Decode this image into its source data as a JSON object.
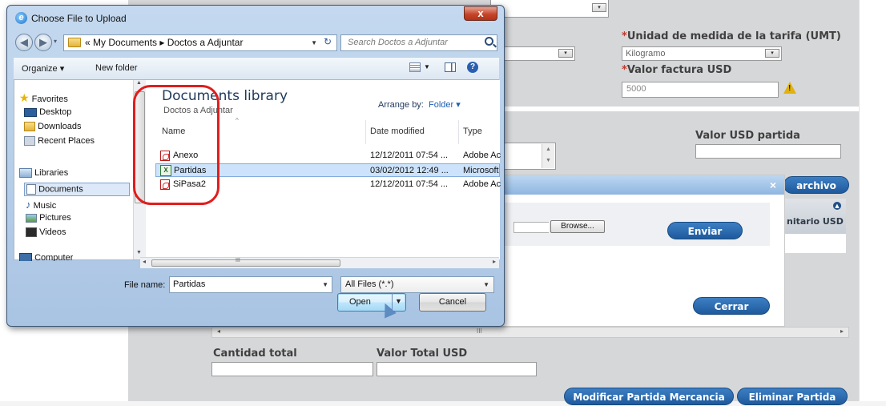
{
  "web": {
    "umt_label": "Unidad de medida de la tarifa (UMT)",
    "umt_value": "Kilogramo",
    "valor_factura_label": "Valor factura USD",
    "valor_factura_value": "5000",
    "valor_usd_partida_label": "Valor USD partida",
    "adjuntar_button": "archivo",
    "precio_unitario_partial": "nitario USD",
    "browse_label": "Browse...",
    "enviar_label": "Enviar",
    "cerrar_label": "Cerrar",
    "cantidad_total_label": "Cantidad total",
    "valor_total_label": "Valor Total USD",
    "modificar_label": "Modificar Partida Mercancia",
    "eliminar_label": "Eliminar Partida",
    "req_mark": "*",
    "x_mark": "×",
    "scroll_mark": "III"
  },
  "dialog": {
    "title": "Choose File to Upload",
    "close_label": "x",
    "breadcrumb": "« My Documents ▸ Doctos a Adjuntar",
    "search_placeholder": "Search Doctos a Adjuntar",
    "organize_label": "Organize ▾",
    "new_folder_label": "New folder",
    "nav": {
      "favorites": "Favorites",
      "desktop": "Desktop",
      "downloads": "Downloads",
      "recent_places": "Recent Places",
      "libraries": "Libraries",
      "documents": "Documents",
      "music": "Music",
      "pictures": "Pictures",
      "videos": "Videos",
      "computer": "Computer"
    },
    "library_title": "Documents library",
    "library_sub": "Doctos a Adjuntar",
    "arrange_label": "Arrange by:",
    "arrange_value": "Folder ▾",
    "columns": {
      "name": "Name",
      "date": "Date modified",
      "type": "Type"
    },
    "files": [
      {
        "name": "Anexo",
        "date": "12/12/2011 07:54 ...",
        "type": "Adobe Ac",
        "icon": "pdf-icon"
      },
      {
        "name": "Partidas",
        "date": "03/02/2012 12:49 ...",
        "type": "Microsoft",
        "icon": "excel-icon"
      },
      {
        "name": "SiPasa2",
        "date": "12/12/2011 07:54 ...",
        "type": "Adobe Ac",
        "icon": "pdf-icon"
      }
    ],
    "file_name_label": "File name:",
    "file_name_value": "Partidas",
    "filter_value": "All Files (*.*)",
    "open_label": "Open",
    "cancel_label": "Cancel",
    "scroll_mark": "III"
  },
  "colors": {
    "highlight_box": "#e11d1d",
    "accent_blue": "#1e5a9c",
    "selection": "#cde3fb"
  }
}
